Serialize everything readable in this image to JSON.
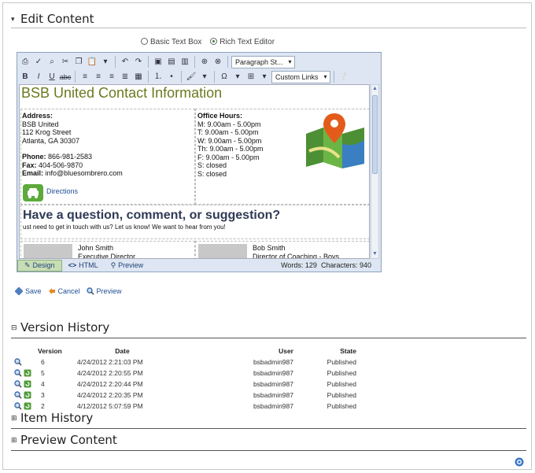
{
  "edit_content": {
    "title": "Edit Content",
    "mode_basic": "Basic Text Box",
    "mode_rich": "Rich Text Editor",
    "toolbar": {
      "paragraph_style": "Paragraph St...",
      "custom_links": "Custom Links",
      "omega": "Ω"
    },
    "doc": {
      "heading": "BSB United Contact Information",
      "address_label": "Address:",
      "address_lines": [
        "BSB United",
        "112 Krog Street",
        "Atlanta, GA 30307"
      ],
      "phone_label": "Phone:",
      "phone": "866-981-2583",
      "fax_label": "Fax:",
      "fax": "404-506-9870",
      "email_label": "Email:",
      "email": "info@bluesombrero.com",
      "office_hours_label": "Office Hours:",
      "hours": [
        "M: 9.00am - 5.00pm",
        "T: 9.00am - 5.00pm",
        "W: 9.00am - 5.00pm",
        "Th: 9.00am - 5.00pm",
        "F: 9.00am - 5.00pm",
        "S: closed",
        "S: closed"
      ],
      "directions": "Directions",
      "question_heading": "Have a question, comment, or suggestion?",
      "question_sub": "ust need to get in touch with us? Let us know! We want to hear from you!",
      "contact1_name": "John Smith",
      "contact1_title": "Executive Director",
      "contact2_name": "Bob Smith",
      "contact2_title": "Director of Coaching - Boys"
    },
    "footer": {
      "design": "Design",
      "html": "HTML",
      "preview": "Preview",
      "words": "Words: 129",
      "characters": "Characters: 940"
    },
    "actions": {
      "save": "Save",
      "cancel": "Cancel",
      "preview": "Preview"
    }
  },
  "version_history": {
    "title": "Version History",
    "columns": [
      "Version",
      "Date",
      "User",
      "State"
    ],
    "rows": [
      {
        "version": "6",
        "date": "4/24/2012 2:21:03 PM",
        "user": "bsbadmin987",
        "state": "Published",
        "restorable": false
      },
      {
        "version": "5",
        "date": "4/24/2012 2:20:55 PM",
        "user": "bsbadmin987",
        "state": "Published",
        "restorable": true
      },
      {
        "version": "4",
        "date": "4/24/2012 2:20:44 PM",
        "user": "bsbadmin987",
        "state": "Published",
        "restorable": true
      },
      {
        "version": "3",
        "date": "4/24/2012 2:20:35 PM",
        "user": "bsbadmin987",
        "state": "Published",
        "restorable": true
      },
      {
        "version": "2",
        "date": "4/12/2012 5:07:59 PM",
        "user": "bsbadmin987",
        "state": "Published",
        "restorable": true
      }
    ]
  },
  "item_history": {
    "title": "Item History"
  },
  "preview_content": {
    "title": "Preview Content"
  },
  "colors": {
    "accent_green": "#5caa3b",
    "link_blue": "#1f4f94",
    "heading_olive": "#6b7a1f"
  }
}
